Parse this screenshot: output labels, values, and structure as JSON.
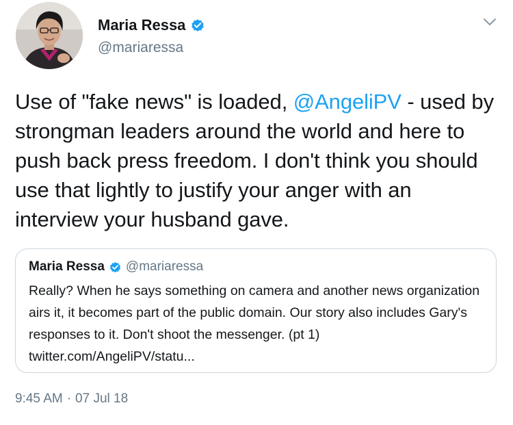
{
  "author": {
    "display_name": "Maria Ressa",
    "handle": "@mariaressa",
    "verified_icon": "verified-badge-icon",
    "avatar_icon": "avatar-photo"
  },
  "menu": {
    "icon": "chevron-down-icon"
  },
  "tweet": {
    "text_part1": "Use of \"fake news\" is loaded, ",
    "mention": "@AngeliPV",
    "text_part2": " - used by strongman leaders around the world and here to push back press freedom. I don't think you should use that lightly to justify your anger with an interview your husband gave."
  },
  "quoted_tweet": {
    "display_name": "Maria Ressa",
    "handle": "@mariaressa",
    "text": "Really? When he says something on camera and another news organization airs it, it becomes part of the public domain. Our story also includes Gary's responses to it. Don't shoot the messenger. (pt 1) twitter.com/AngeliPV/statu..."
  },
  "meta": {
    "time": "9:45 AM",
    "separator": "·",
    "date": "07 Jul 18"
  },
  "colors": {
    "link": "#1da1f2",
    "secondary_text": "#657786",
    "border": "#ccd6dd",
    "verified": "#1da1f2"
  }
}
